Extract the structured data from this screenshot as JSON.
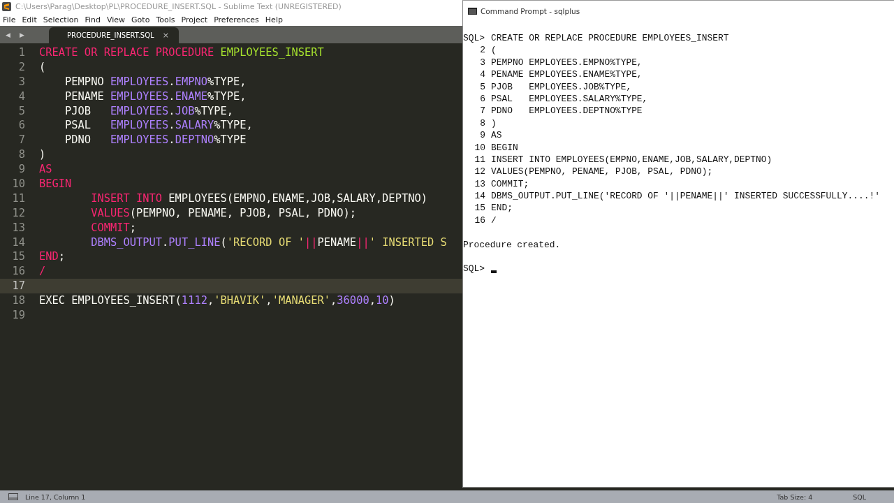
{
  "editor_window": {
    "title": "C:\\Users\\Parag\\Desktop\\PL\\PROCEDURE_INSERT.SQL - Sublime Text (UNREGISTERED)",
    "menu": [
      "File",
      "Edit",
      "Selection",
      "Find",
      "View",
      "Goto",
      "Tools",
      "Project",
      "Preferences",
      "Help"
    ],
    "tab_nav": [
      "◀",
      "▶"
    ],
    "tabs": [
      {
        "label": "PROCEDURE_INSERT.SQL",
        "close": "×",
        "selected": true
      }
    ],
    "code": [
      {
        "number": "1",
        "current": false,
        "tokens": [
          {
            "text": "CREATE OR REPLACE PROCEDURE ",
            "kind": "keyword"
          },
          {
            "text": "EMPLOYEES_INSERT",
            "kind": "name"
          }
        ]
      },
      {
        "number": "2",
        "current": false,
        "tokens": [
          {
            "text": "(",
            "kind": "plain"
          }
        ]
      },
      {
        "number": "3",
        "current": false,
        "tokens": [
          {
            "text": "    PEMPNO ",
            "kind": "plain"
          },
          {
            "text": "EMPLOYEES",
            "kind": "ref"
          },
          {
            "text": ".",
            "kind": "plain"
          },
          {
            "text": "EMPNO",
            "kind": "ref"
          },
          {
            "text": "%TYPE,",
            "kind": "plain"
          }
        ]
      },
      {
        "number": "4",
        "current": false,
        "tokens": [
          {
            "text": "    PENAME ",
            "kind": "plain"
          },
          {
            "text": "EMPLOYEES",
            "kind": "ref"
          },
          {
            "text": ".",
            "kind": "plain"
          },
          {
            "text": "ENAME",
            "kind": "ref"
          },
          {
            "text": "%TYPE,",
            "kind": "plain"
          }
        ]
      },
      {
        "number": "5",
        "current": false,
        "tokens": [
          {
            "text": "    PJOB   ",
            "kind": "plain"
          },
          {
            "text": "EMPLOYEES",
            "kind": "ref"
          },
          {
            "text": ".",
            "kind": "plain"
          },
          {
            "text": "JOB",
            "kind": "ref"
          },
          {
            "text": "%TYPE,",
            "kind": "plain"
          }
        ]
      },
      {
        "number": "6",
        "current": false,
        "tokens": [
          {
            "text": "    PSAL   ",
            "kind": "plain"
          },
          {
            "text": "EMPLOYEES",
            "kind": "ref"
          },
          {
            "text": ".",
            "kind": "plain"
          },
          {
            "text": "SALARY",
            "kind": "ref"
          },
          {
            "text": "%TYPE,",
            "kind": "plain"
          }
        ]
      },
      {
        "number": "7",
        "current": false,
        "tokens": [
          {
            "text": "    PDNO   ",
            "kind": "plain"
          },
          {
            "text": "EMPLOYEES",
            "kind": "ref"
          },
          {
            "text": ".",
            "kind": "plain"
          },
          {
            "text": "DEPTNO",
            "kind": "ref"
          },
          {
            "text": "%TYPE",
            "kind": "plain"
          }
        ]
      },
      {
        "number": "8",
        "current": false,
        "tokens": [
          {
            "text": ")",
            "kind": "plain"
          }
        ]
      },
      {
        "number": "9",
        "current": false,
        "tokens": [
          {
            "text": "AS",
            "kind": "keyword"
          }
        ]
      },
      {
        "number": "10",
        "current": false,
        "tokens": [
          {
            "text": "BEGIN",
            "kind": "keyword"
          }
        ]
      },
      {
        "number": "11",
        "current": false,
        "tokens": [
          {
            "text": "        INSERT INTO ",
            "kind": "keyword"
          },
          {
            "text": "EMPLOYEES(EMPNO,ENAME,JOB,SALARY,DEPTNO)",
            "kind": "plain"
          }
        ]
      },
      {
        "number": "12",
        "current": false,
        "tokens": [
          {
            "text": "        VALUES",
            "kind": "keyword"
          },
          {
            "text": "(PEMPNO, PENAME, PJOB, PSAL, PDNO);",
            "kind": "plain"
          }
        ]
      },
      {
        "number": "13",
        "current": false,
        "tokens": [
          {
            "text": "        COMMIT",
            "kind": "keyword"
          },
          {
            "text": ";",
            "kind": "plain"
          }
        ]
      },
      {
        "number": "14",
        "current": false,
        "tokens": [
          {
            "text": "        DBMS_OUTPUT",
            "kind": "ref"
          },
          {
            "text": ".",
            "kind": "plain"
          },
          {
            "text": "PUT_LINE",
            "kind": "ref"
          },
          {
            "text": "(",
            "kind": "plain"
          },
          {
            "text": "'RECORD OF '",
            "kind": "string"
          },
          {
            "text": "||",
            "kind": "keyword"
          },
          {
            "text": "PENAME",
            "kind": "plain"
          },
          {
            "text": "||",
            "kind": "keyword"
          },
          {
            "text": "' INSERTED S",
            "kind": "string"
          }
        ]
      },
      {
        "number": "15",
        "current": false,
        "tokens": [
          {
            "text": "END",
            "kind": "keyword"
          },
          {
            "text": ";",
            "kind": "plain"
          }
        ]
      },
      {
        "number": "16",
        "current": false,
        "tokens": [
          {
            "text": "/",
            "kind": "keyword"
          }
        ]
      },
      {
        "number": "17",
        "current": true
      },
      {
        "number": "18",
        "current": false,
        "tokens": [
          {
            "text": "EXEC EMPLOYEES_INSERT(",
            "kind": "plain"
          },
          {
            "text": "1112",
            "kind": "ref"
          },
          {
            "text": ",",
            "kind": "plain"
          },
          {
            "text": "'BHAVIK'",
            "kind": "string"
          },
          {
            "text": ",",
            "kind": "plain"
          },
          {
            "text": "'MANAGER'",
            "kind": "string"
          },
          {
            "text": ",",
            "kind": "plain"
          },
          {
            "text": "36000",
            "kind": "ref"
          },
          {
            "text": ",",
            "kind": "plain"
          },
          {
            "text": "10",
            "kind": "ref"
          },
          {
            "text": ")",
            "kind": "plain"
          }
        ]
      },
      {
        "number": "19",
        "current": false
      }
    ],
    "status_bar": {
      "position": "Line 17, Column 1",
      "tab_size": "Tab Size: 4",
      "syntax": "SQL"
    }
  },
  "console_window": {
    "title": "Command Prompt - sqlplus",
    "lines": [
      {
        "prompt": "SQL>",
        "text": "CREATE OR REPLACE PROCEDURE EMPLOYEES_INSERT"
      },
      {
        "number": "2",
        "text": "("
      },
      {
        "number": "3",
        "text": "PEMPNO EMPLOYEES.EMPNO%TYPE,"
      },
      {
        "number": "4",
        "text": "PENAME EMPLOYEES.ENAME%TYPE,"
      },
      {
        "number": "5",
        "text": "PJOB   EMPLOYEES.JOB%TYPE,"
      },
      {
        "number": "6",
        "text": "PSAL   EMPLOYEES.SALARY%TYPE,"
      },
      {
        "number": "7",
        "text": "PDNO   EMPLOYEES.DEPTNO%TYPE"
      },
      {
        "number": "8",
        "text": ")"
      },
      {
        "number": "9",
        "text": "AS"
      },
      {
        "number": "10",
        "text": "BEGIN"
      },
      {
        "number": "11",
        "text": "INSERT INTO EMPLOYEES(EMPNO,ENAME,JOB,SALARY,DEPTNO)"
      },
      {
        "number": "12",
        "text": "VALUES(PEMPNO, PENAME, PJOB, PSAL, PDNO);"
      },
      {
        "number": "13",
        "text": "COMMIT;"
      },
      {
        "number": "14",
        "text": "DBMS_OUTPUT.PUT_LINE('RECORD OF '||PENAME||' INSERTED SUCCESSFULLY....!'"
      },
      {
        "number": "15",
        "text": "END;"
      },
      {
        "number": "16",
        "text": "/"
      },
      {
        "output": "Procedure created."
      },
      {
        "prompt": "SQL>",
        "cursor": true
      }
    ]
  }
}
